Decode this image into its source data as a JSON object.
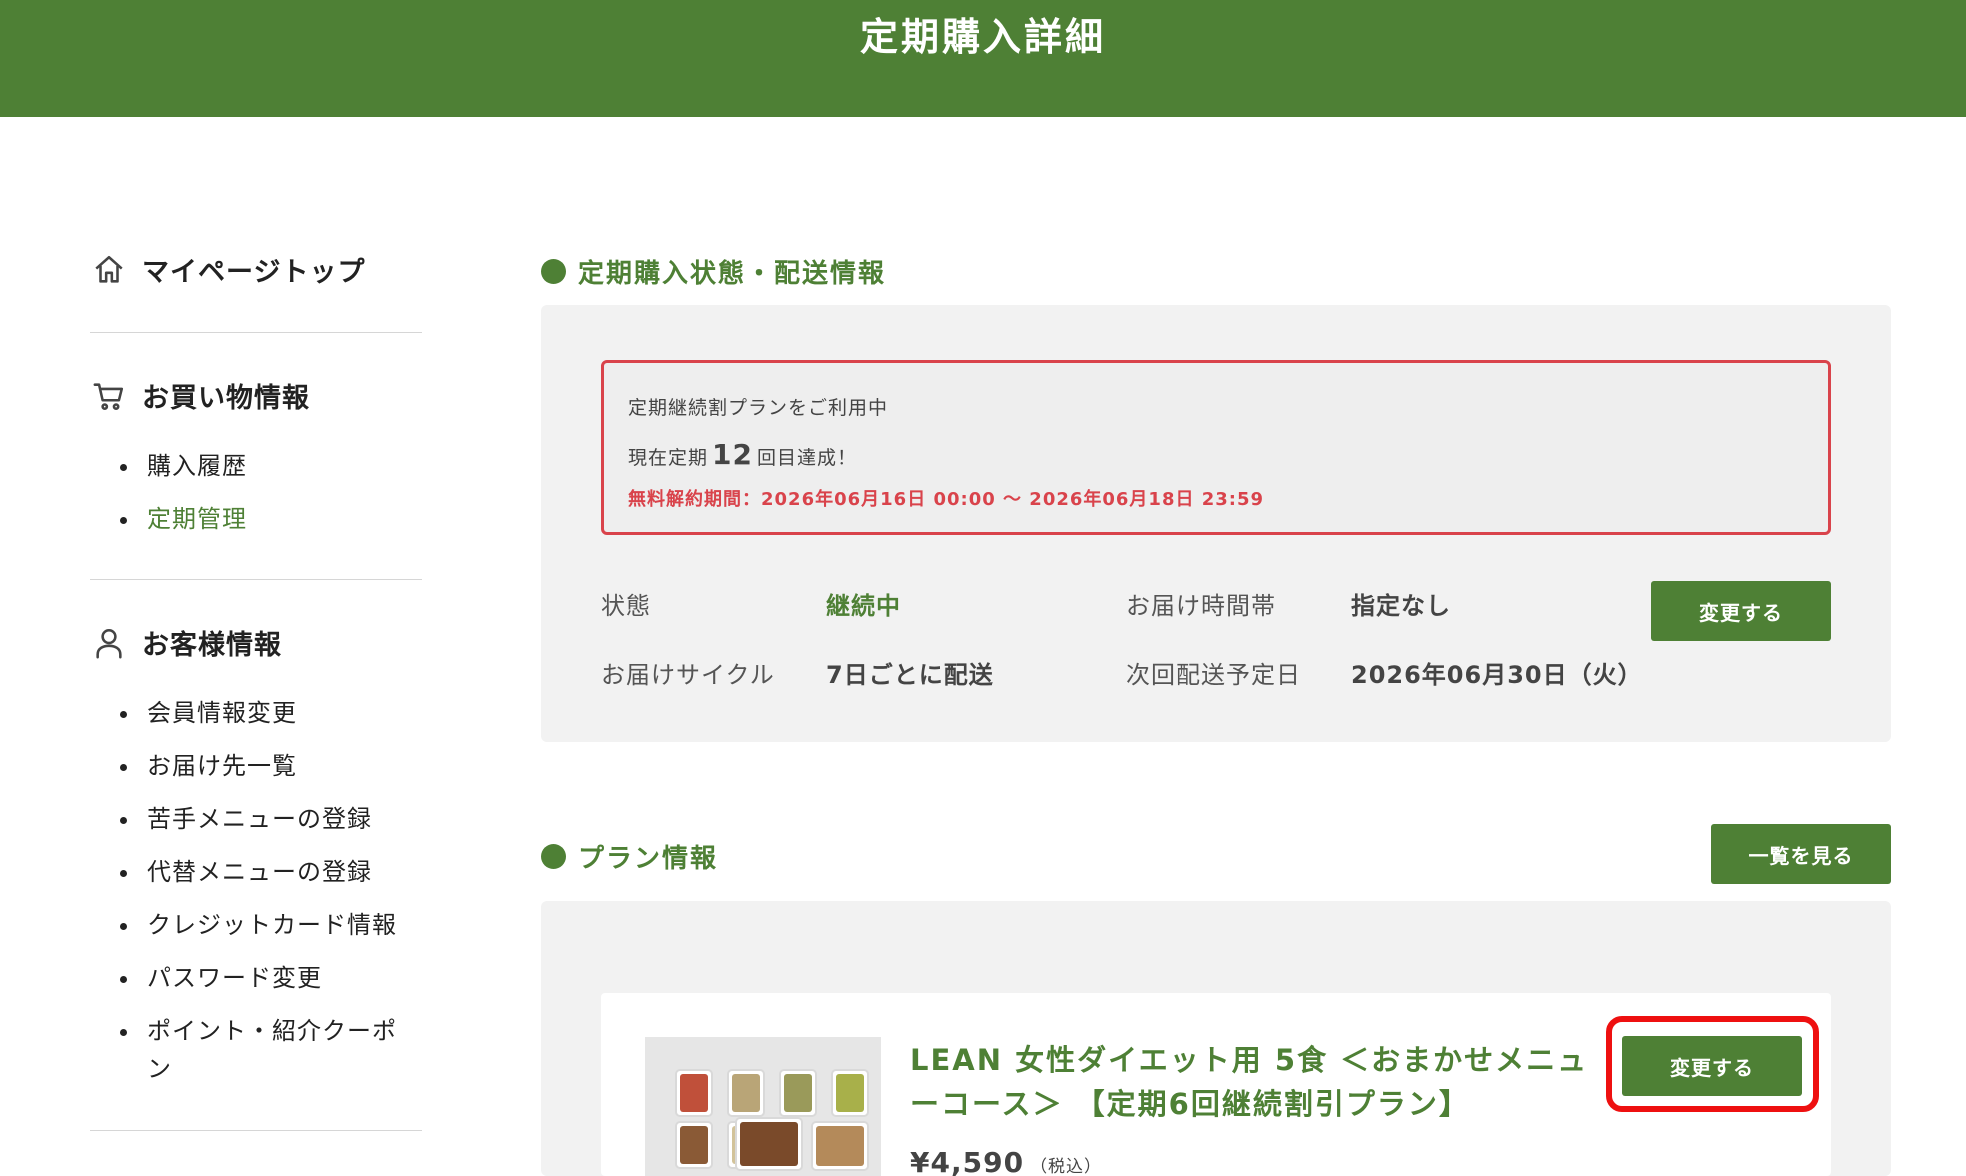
{
  "header": {
    "title": "定期購入詳細"
  },
  "sidebar": {
    "top_link": {
      "label": "マイページトップ",
      "icon": "home-icon"
    },
    "shopping": {
      "title": "お買い物情報",
      "icon": "cart-icon",
      "items": [
        {
          "label": "購入履歴",
          "active": false
        },
        {
          "label": "定期管理",
          "active": true
        }
      ]
    },
    "customer": {
      "title": "お客様情報",
      "icon": "user-icon",
      "items": [
        {
          "label": "会員情報変更"
        },
        {
          "label": "お届け先一覧"
        },
        {
          "label": "苦手メニューの登録"
        },
        {
          "label": "代替メニューの登録"
        },
        {
          "label": "クレジットカード情報"
        },
        {
          "label": "パスワード変更"
        },
        {
          "label": "ポイント・紹介クーポン"
        }
      ]
    }
  },
  "subscription": {
    "section_title": "定期購入状態・配送情報",
    "notice": {
      "line1": "定期継続割プランをご利用中",
      "line2_prefix": "現在定期",
      "line2_count": "12",
      "line2_suffix": "回目達成！",
      "cancel_period": "無料解約期間：2026年06月16日 00:00 〜 2026年06月18日 23:59"
    },
    "status_label": "状態",
    "status_value": "継続中",
    "time_label": "お届け時間帯",
    "time_value": "指定なし",
    "cycle_label": "お届けサイクル",
    "cycle_value": "7日ごとに配送",
    "next_label": "次回配送予定日",
    "next_value": "2026年06月30日（火）",
    "change_button": "変更する"
  },
  "plan": {
    "section_title": "プラン情報",
    "view_all_button": "一覧を見る",
    "product_name": "LEAN 女性ダイエット用 5食 ＜おまかせメニューコース＞ 【定期6回継続割引プラン】",
    "price": "¥4,590",
    "tax_note": "（税込）",
    "change_button": "変更する"
  },
  "colors": {
    "brand": "#4e8035",
    "alert": "#d9434b",
    "highlight": "#ee1010"
  }
}
